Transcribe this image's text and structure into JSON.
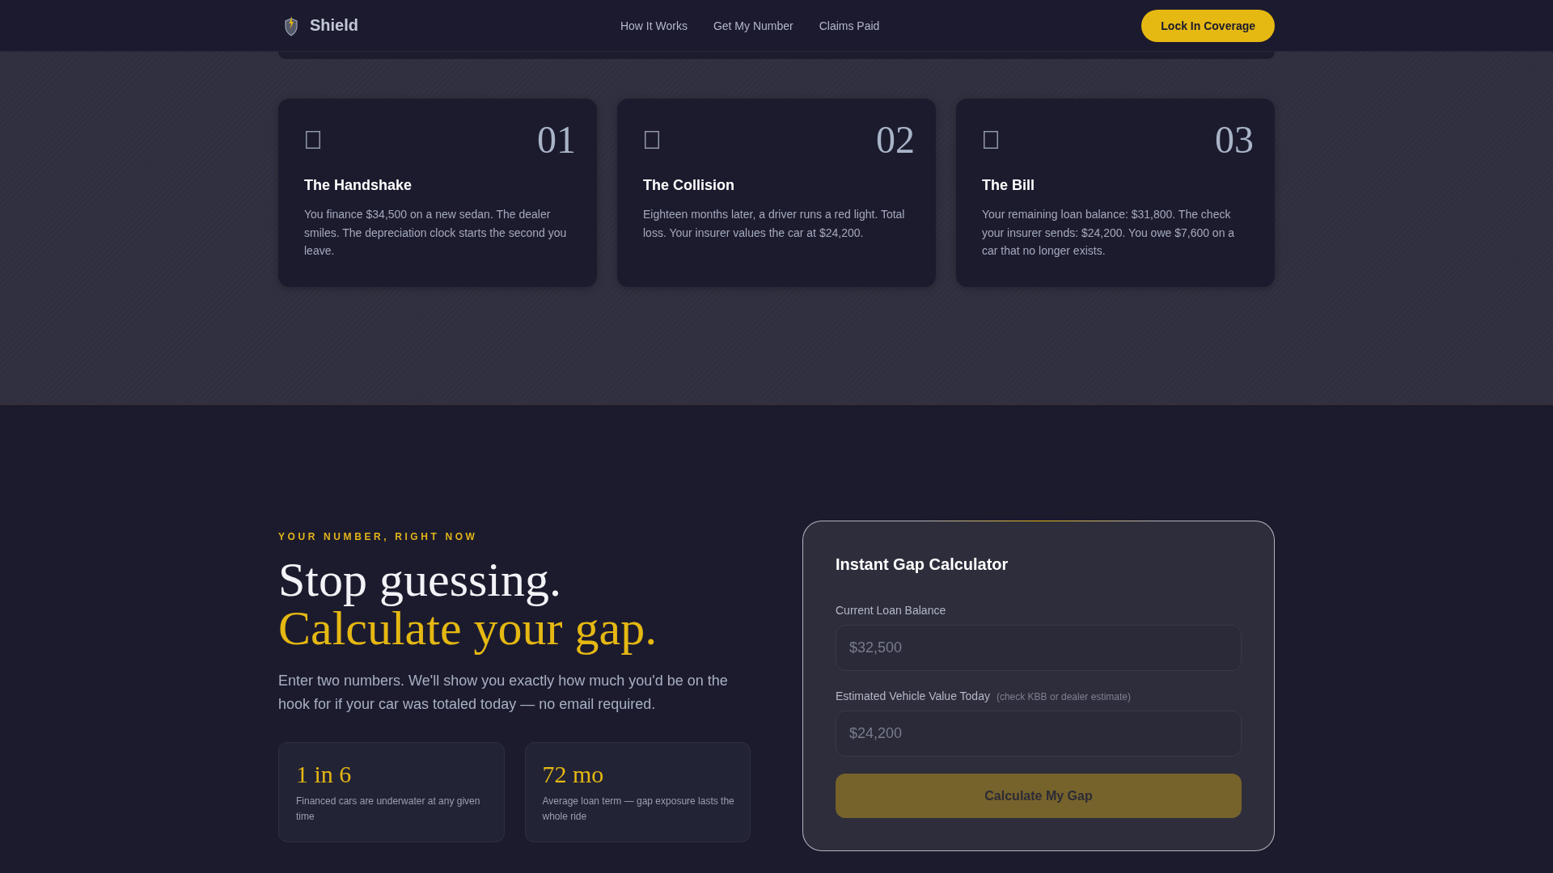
{
  "header": {
    "brand": "Shield",
    "nav": [
      "How It Works",
      "Get My Number",
      "Claims Paid"
    ],
    "cta": "Lock In Coverage"
  },
  "steps": [
    {
      "number": "01",
      "title": "The Handshake",
      "text": "You finance $34,500 on a new sedan. The dealer smiles. The depreciation clock starts the second you leave."
    },
    {
      "number": "02",
      "title": "The Collision",
      "text": "Eighteen months later, a driver runs a red light. Total loss. Your insurer values the car at $24,200."
    },
    {
      "number": "03",
      "title": "The Bill",
      "text": "Your remaining loan balance: $31,800. The check your insurer sends: $24,200. You owe $7,600 on a car that no longer exists."
    }
  ],
  "gap_section": {
    "eyebrow": "YOUR NUMBER, RIGHT NOW",
    "heading": [
      {
        "text": "Stop guessing.",
        "highlighted": false
      },
      {
        "text": "Calculate your gap.",
        "highlighted": true
      }
    ],
    "intro": "Enter two numbers. We'll show you exactly how much you'd be on the hook for if your car was totaled today — no email required.",
    "stats": [
      {
        "value": "1 in 6",
        "caption": "Financed cars are underwater at any given time"
      },
      {
        "value": "72 mo",
        "caption": "Average loan term — gap exposure lasts the whole ride"
      }
    ]
  },
  "calculator": {
    "title": "Instant Gap Calculator",
    "fields": [
      {
        "label": "Current Loan Balance",
        "placeholder": "$32,500"
      },
      {
        "label": "Estimated Vehicle Value Today",
        "hint": "(check KBB or dealer estimate)",
        "placeholder": "$24,200"
      }
    ],
    "button": {
      "label": "Calculate My Gap",
      "disabled": true
    }
  }
}
